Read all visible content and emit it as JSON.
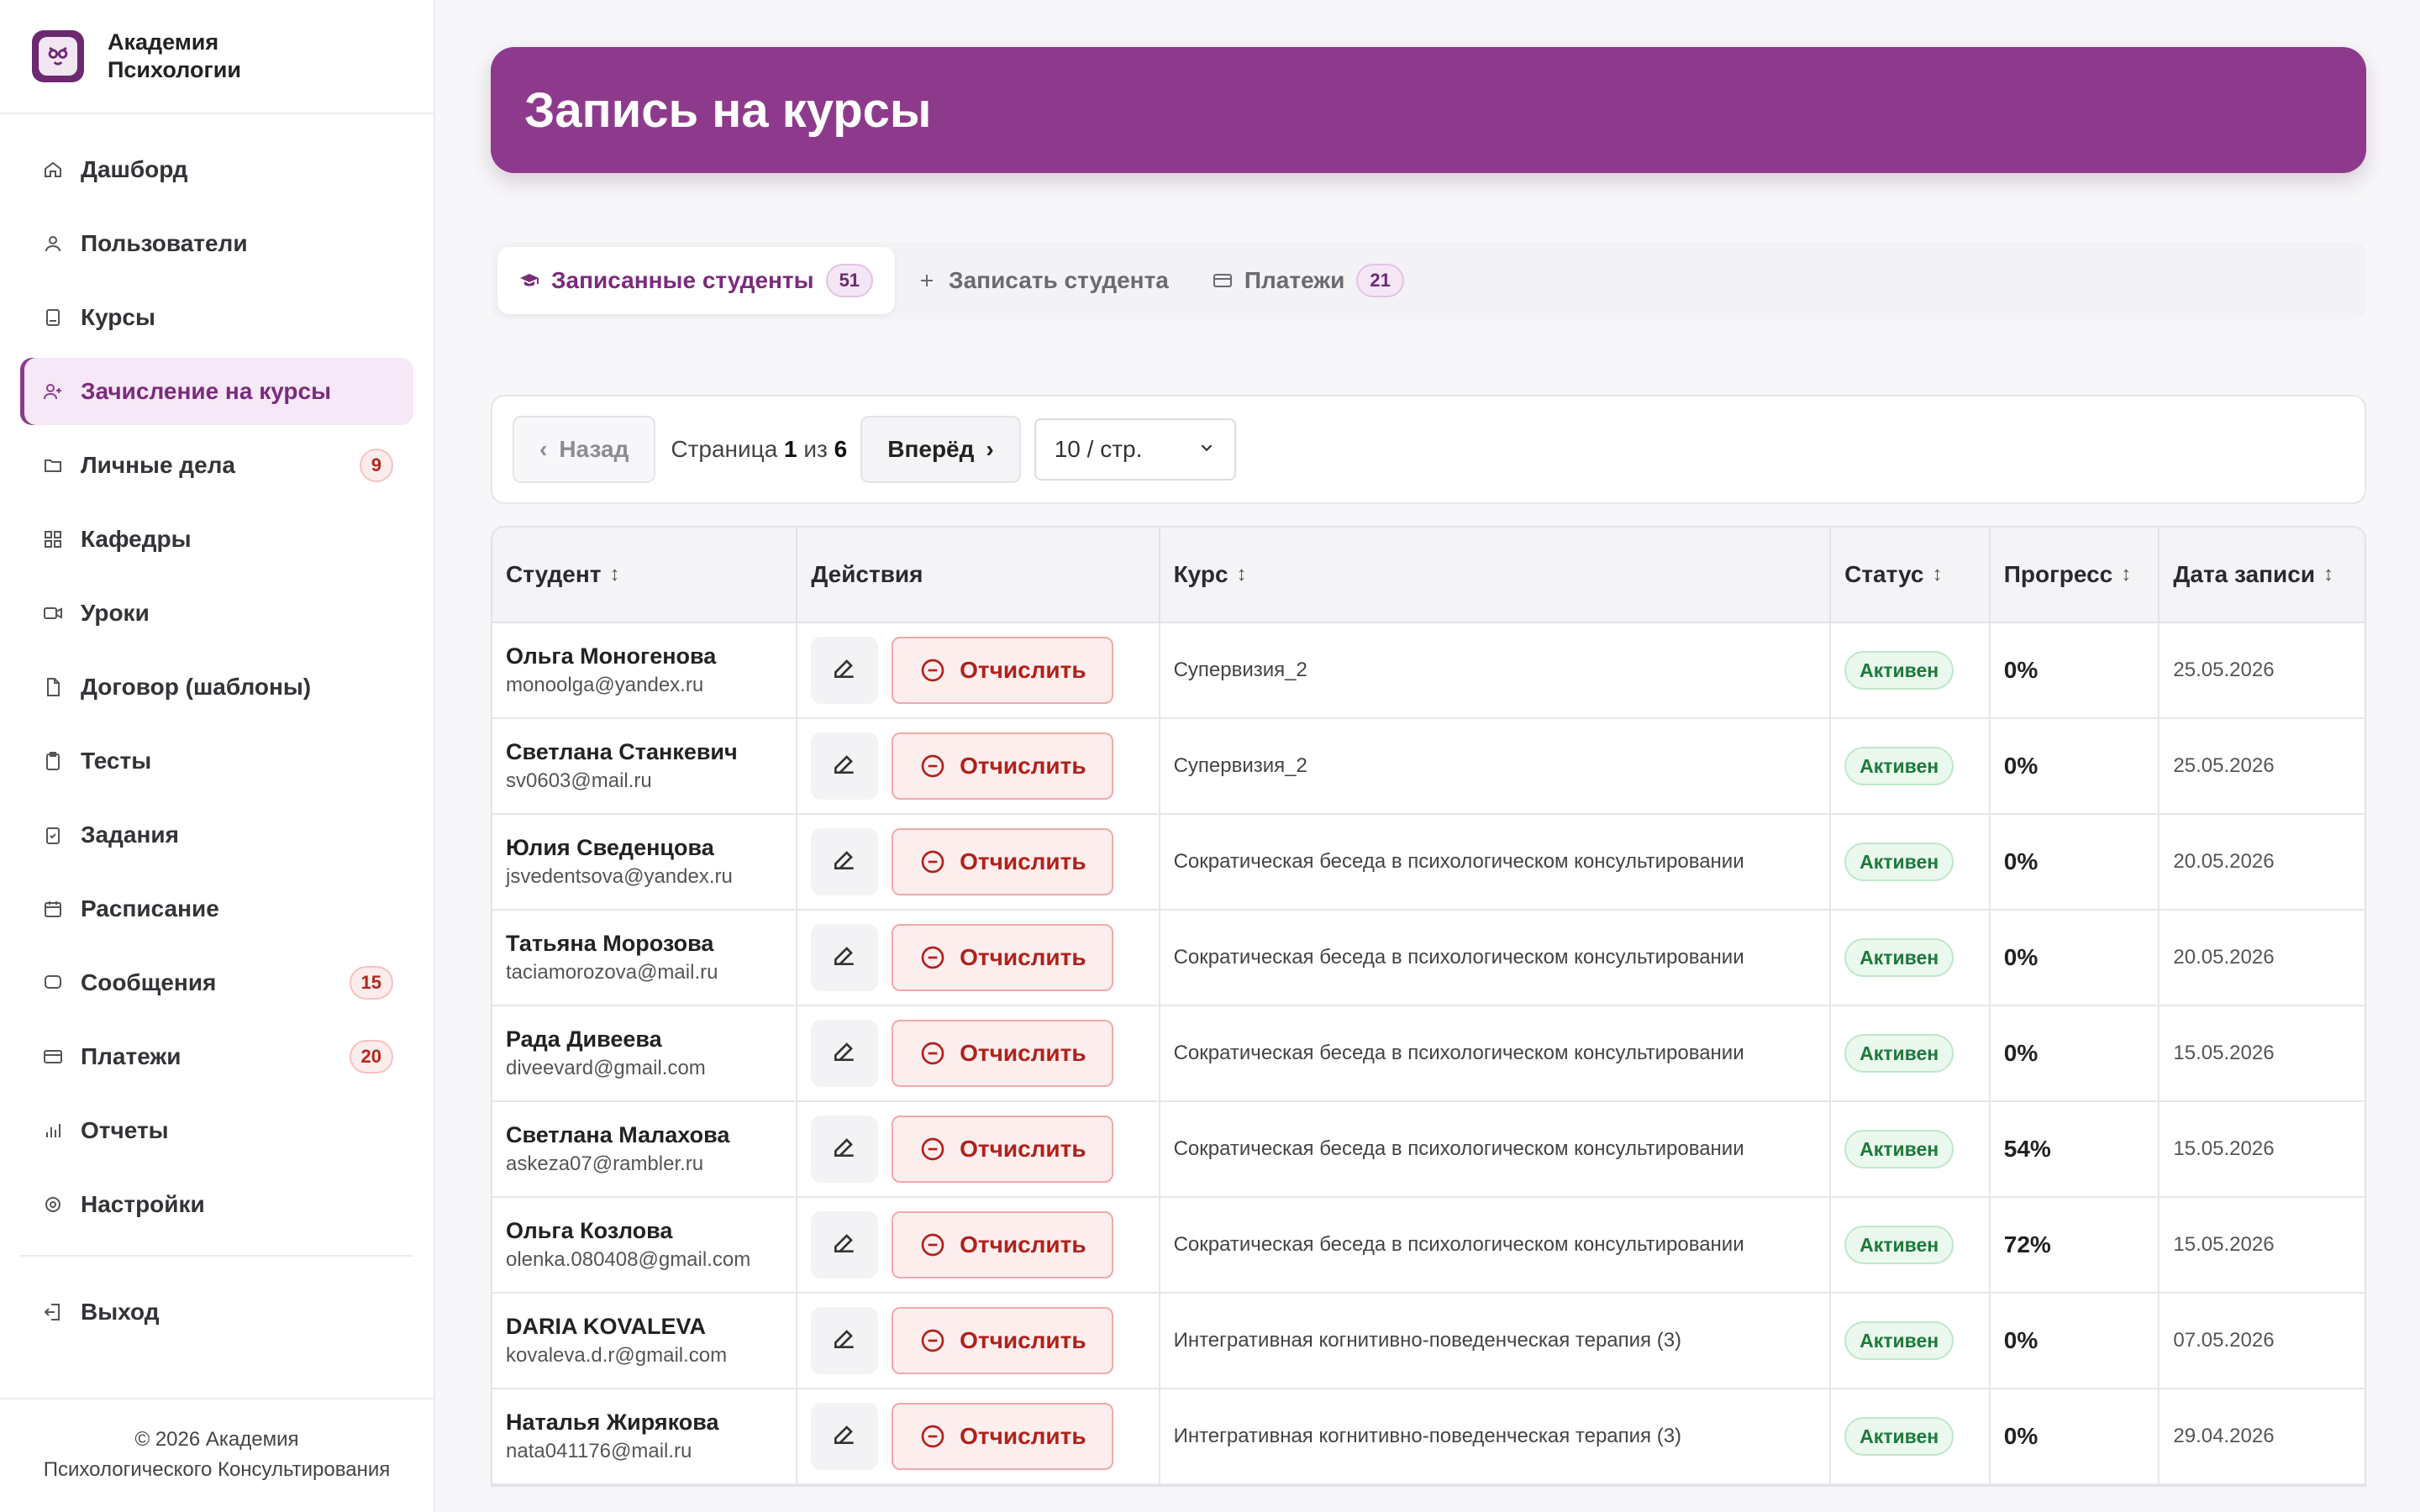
{
  "brand": {
    "name_line1": "Академия",
    "name_line2": "Психологии"
  },
  "sidebar": {
    "items": [
      {
        "label": "Дашборд",
        "icon": "home-icon"
      },
      {
        "label": "Пользователи",
        "icon": "user-icon"
      },
      {
        "label": "Курсы",
        "icon": "book-icon"
      },
      {
        "label": "Зачисление на курсы",
        "icon": "user-plus-icon",
        "active": true
      },
      {
        "label": "Личные дела",
        "icon": "folder-icon",
        "badge": "9"
      },
      {
        "label": "Кафедры",
        "icon": "grid-icon"
      },
      {
        "label": "Уроки",
        "icon": "video-icon"
      },
      {
        "label": "Договор (шаблоны)",
        "icon": "document-icon"
      },
      {
        "label": "Тесты",
        "icon": "clipboard-icon"
      },
      {
        "label": "Задания",
        "icon": "task-icon"
      },
      {
        "label": "Расписание",
        "icon": "calendar-icon"
      },
      {
        "label": "Сообщения",
        "icon": "chat-icon",
        "badge": "15"
      },
      {
        "label": "Платежи",
        "icon": "card-icon",
        "badge": "20"
      },
      {
        "label": "Отчеты",
        "icon": "bar-chart-icon"
      },
      {
        "label": "Настройки",
        "icon": "gear-icon"
      }
    ],
    "logout": "Выход",
    "footer_line1": "© 2026 Академия",
    "footer_line2": "Психологического Консультирования"
  },
  "header": {
    "title": "Запись на курсы"
  },
  "tabs": [
    {
      "label": "Записанные студенты",
      "badge": "51",
      "icon": "graduation-cap-icon"
    },
    {
      "label": "Записать студента",
      "icon": "plus-icon"
    },
    {
      "label": "Платежи",
      "badge": "21",
      "icon": "card-icon"
    }
  ],
  "pagination": {
    "prev": "Назад",
    "next": "Вперёд",
    "page_word": "Страница",
    "current": "1",
    "of_word": "из",
    "total": "6",
    "page_size": "10 / стр."
  },
  "table": {
    "columns": [
      "Студент",
      "Действия",
      "Курс",
      "Статус",
      "Прогресс",
      "Дата записи"
    ],
    "expel_label": "Отчислить",
    "rows": [
      {
        "name": "Ольга Моногенова",
        "email": "monoolga@yandex.ru",
        "course": "Супервизия_2",
        "status": "Активен",
        "progress": "0%",
        "date": "25.05.2026"
      },
      {
        "name": "Светлана Станкевич",
        "email": "sv0603@mail.ru",
        "course": "Супервизия_2",
        "status": "Активен",
        "progress": "0%",
        "date": "25.05.2026"
      },
      {
        "name": "Юлия Сведенцова",
        "email": "jsvedentsova@yandex.ru",
        "course": "Сократическая беседа в психологическом консультировании",
        "status": "Активен",
        "progress": "0%",
        "date": "20.05.2026"
      },
      {
        "name": "Татьяна Морозова",
        "email": "taciamorozova@mail.ru",
        "course": "Сократическая беседа в психологическом консультировании",
        "status": "Активен",
        "progress": "0%",
        "date": "20.05.2026"
      },
      {
        "name": "Рада Дивеева",
        "email": "diveevard@gmail.com",
        "course": "Сократическая беседа в психологическом консультировании",
        "status": "Активен",
        "progress": "0%",
        "date": "15.05.2026"
      },
      {
        "name": "Светлана Малахова",
        "email": "askeza07@rambler.ru",
        "course": "Сократическая беседа в психологическом консультировании",
        "status": "Активен",
        "progress": "54%",
        "date": "15.05.2026"
      },
      {
        "name": "Ольга Козлова",
        "email": "olenka.080408@gmail.com",
        "course": "Сократическая беседа в психологическом консультировании",
        "status": "Активен",
        "progress": "72%",
        "date": "15.05.2026"
      },
      {
        "name": "DARIA KOVALEVA",
        "email": "kovaleva.d.r@gmail.com",
        "course": "Интегративная когнитивно-поведенческая терапия (3)",
        "status": "Активен",
        "progress": "0%",
        "date": "07.05.2026"
      },
      {
        "name": "Наталья Жирякова",
        "email": "nata041176@mail.ru",
        "course": "Интегративная когнитивно-поведенческая терапия (3)",
        "status": "Активен",
        "progress": "0%",
        "date": "29.04.2026"
      }
    ]
  },
  "colors": {
    "accent": "#8e3a8c",
    "danger": "#b3201a",
    "success": "#1c7a3a"
  }
}
